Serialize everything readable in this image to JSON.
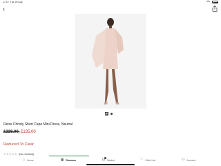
{
  "status_bar": {
    "time": "17:12",
    "date": "Tue 20 Aug"
  },
  "product": {
    "name": "Reiss Christy Short Cape Mini Dress, Neutral",
    "price_old": "£238.00,",
    "price_new": "£135.00",
    "sale_label": "Reduced To Clear",
    "rating_stars": "☆☆☆☆☆",
    "reviews": "(No reviews)",
    "image_index": 1,
    "image_count": 2
  },
  "tabs": [
    {
      "label": "Home",
      "icon": "home-icon",
      "glyph": "⌂",
      "active": false
    },
    {
      "label": "Discover",
      "icon": "discover-icon",
      "glyph": "◎",
      "active": true
    },
    {
      "label": "Basket",
      "icon": "basket-icon",
      "glyph": "⊡",
      "active": false,
      "badge": "2"
    },
    {
      "label": "Wish List",
      "icon": "heart-icon",
      "glyph": "♡",
      "active": false
    },
    {
      "label": "Account",
      "icon": "account-icon",
      "glyph": "⚇",
      "active": false
    }
  ],
  "colors": {
    "sale": "#c0392b",
    "accent": "#2e8b57",
    "dress": "#ecd2c8"
  }
}
